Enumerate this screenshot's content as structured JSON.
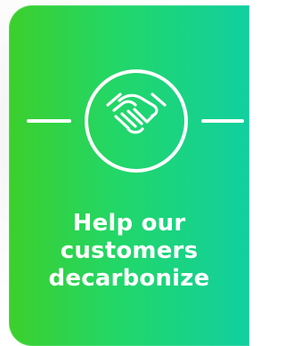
{
  "card": {
    "icon": "handshake-icon",
    "title_lines": [
      "Help our",
      "customers",
      "decarbonize"
    ]
  }
}
